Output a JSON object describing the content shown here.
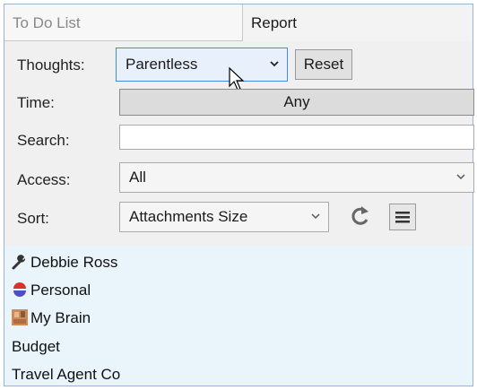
{
  "tabs": {
    "todo": "To Do List",
    "report": "Report"
  },
  "thoughts": {
    "label": "Thoughts:",
    "value": "Parentless",
    "reset": "Reset"
  },
  "time": {
    "label": "Time:",
    "value": "Any"
  },
  "search": {
    "label": "Search:",
    "value": ""
  },
  "access": {
    "label": "Access:",
    "value": "All"
  },
  "sort": {
    "label": "Sort:",
    "value": "Attachments Size"
  },
  "results": [
    {
      "label": "Debbie Ross",
      "icon": "wrench-icon"
    },
    {
      "label": "Personal",
      "icon": "personal-icon"
    },
    {
      "label": "My Brain",
      "icon": "brain-photo-icon"
    },
    {
      "label": "Budget",
      "icon": ""
    },
    {
      "label": "Travel Agent Co",
      "icon": ""
    }
  ]
}
